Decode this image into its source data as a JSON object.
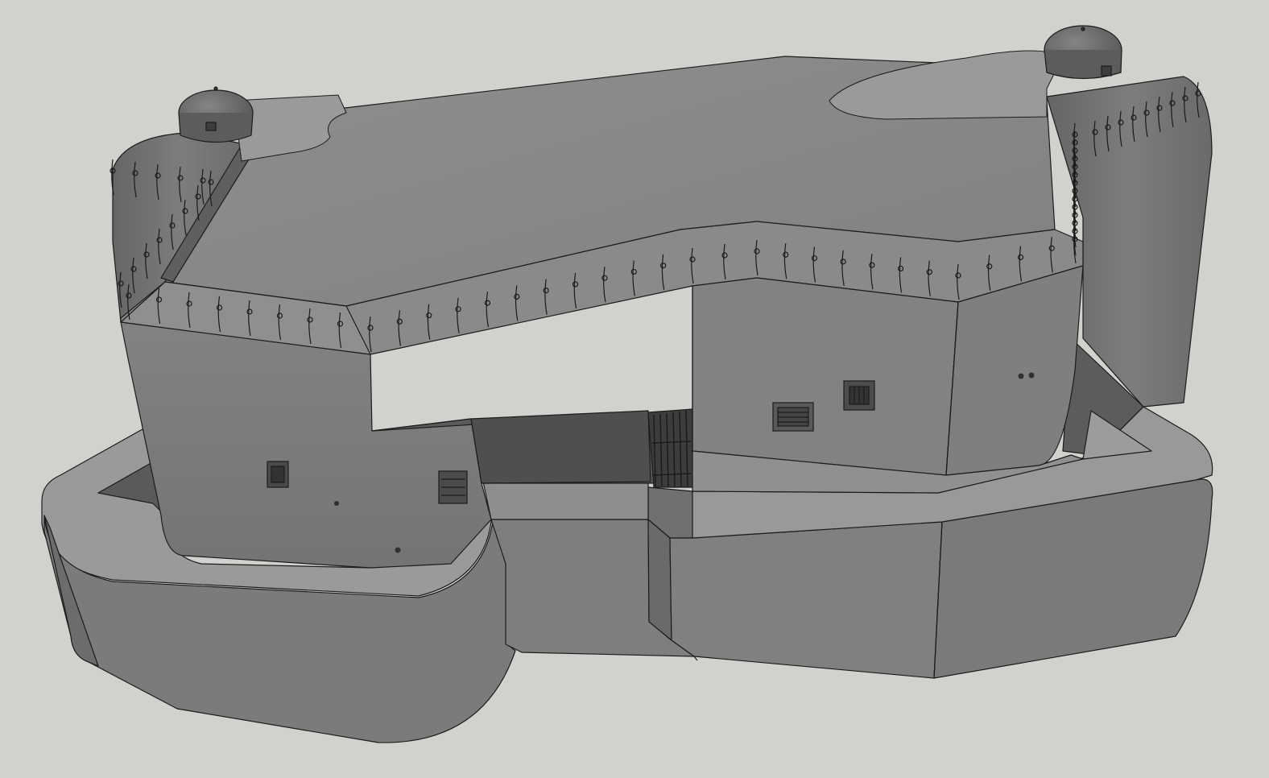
{
  "viewport": {
    "background_color": "#d1d2cd",
    "render_style": "shaded-with-edges",
    "edge_color": "#1c1c1c"
  },
  "model": {
    "subject": "concrete-bunker",
    "palette": {
      "top_light": "#8c8c8c",
      "top_mid": "#838383",
      "wall_front": "#7a7a7a",
      "wall_side": "#6f6f6f",
      "wall_dark": "#5e5e5e",
      "interior_shadow": "#4a4a4a",
      "ledge": "#9a9a9a",
      "dome": "#6a6a6a"
    },
    "features": [
      {
        "name": "flat-roof"
      },
      {
        "name": "left-cupola"
      },
      {
        "name": "right-cupola"
      },
      {
        "name": "barbed-wire-stakes"
      },
      {
        "name": "perimeter-moat-wall"
      },
      {
        "name": "entrance-gate"
      },
      {
        "name": "vent-grilles"
      },
      {
        "name": "firing-loopholes"
      }
    ]
  }
}
